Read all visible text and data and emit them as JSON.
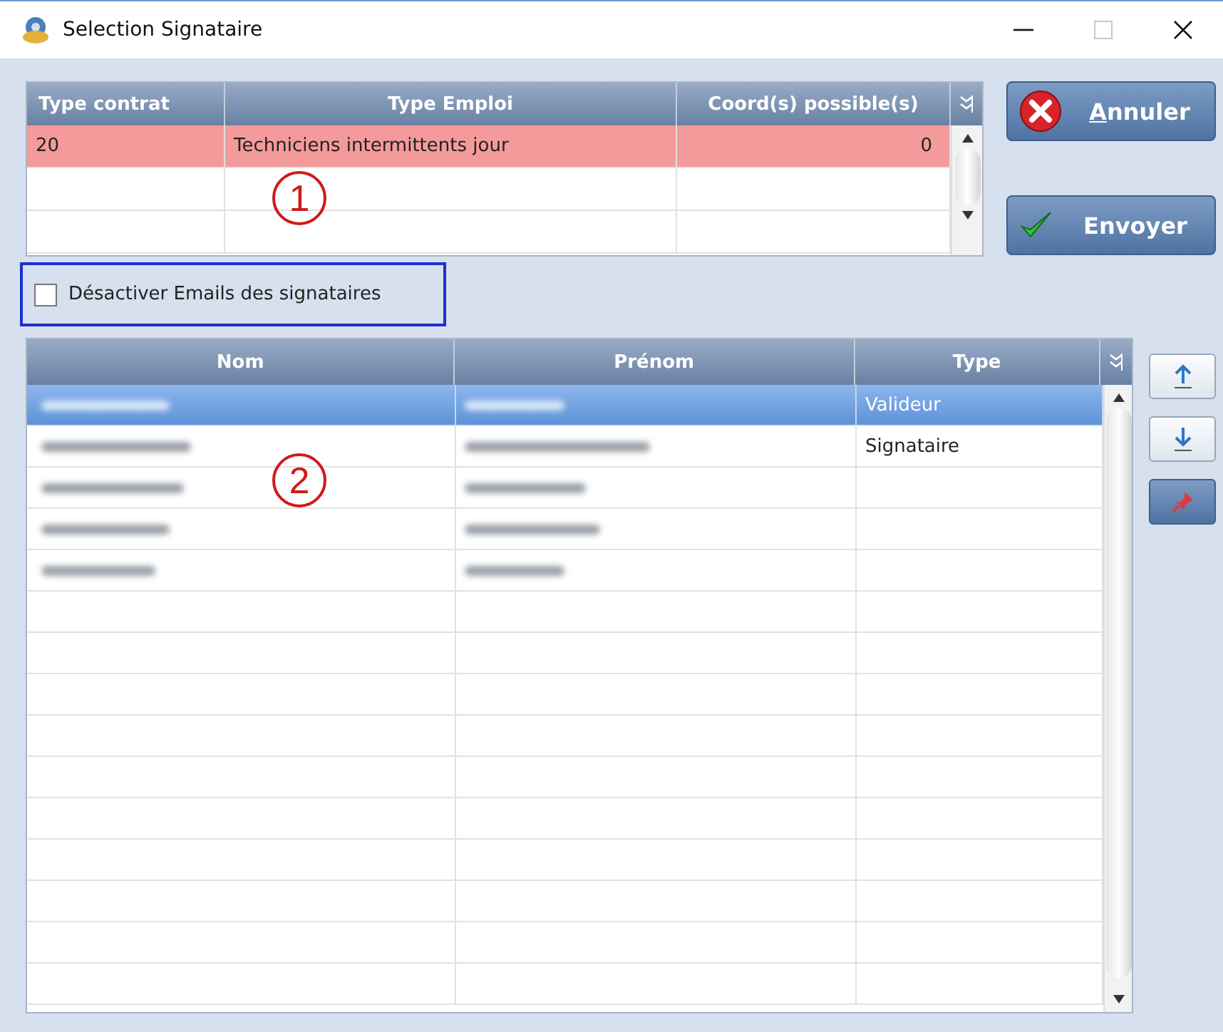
{
  "window": {
    "title": "Selection Signataire",
    "controls": [
      {
        "kind": "minimize"
      },
      {
        "kind": "maximize"
      },
      {
        "kind": "close"
      }
    ]
  },
  "contract_table": {
    "columns": [
      "Type contrat",
      "Type Emploi",
      "Coord(s) possible(s)"
    ],
    "annotation": "1",
    "rows": [
      {
        "cells": [
          "20",
          "Techniciens intermittents jour",
          "0"
        ],
        "selected": true
      }
    ]
  },
  "buttons": [
    {
      "kind": "cancel",
      "label": "Annuler",
      "underline_first": true
    },
    {
      "kind": "send",
      "label": "Envoyer",
      "underline_first": false
    }
  ],
  "email_checkbox": {
    "label": "Désactiver Emails des signataires",
    "checked": false
  },
  "signer_table": {
    "columns": [
      "Nom",
      "Prénom",
      "Type"
    ],
    "annotation": "2",
    "rows": [
      {
        "type": "Valideur",
        "selected": true
      },
      {
        "type": "Signataire",
        "selected": false
      },
      {
        "selected": false
      },
      {
        "selected": false
      },
      {
        "selected": false
      }
    ]
  },
  "side_buttons": [
    {
      "kind": "up"
    },
    {
      "kind": "down"
    },
    {
      "kind": "pin"
    }
  ]
}
